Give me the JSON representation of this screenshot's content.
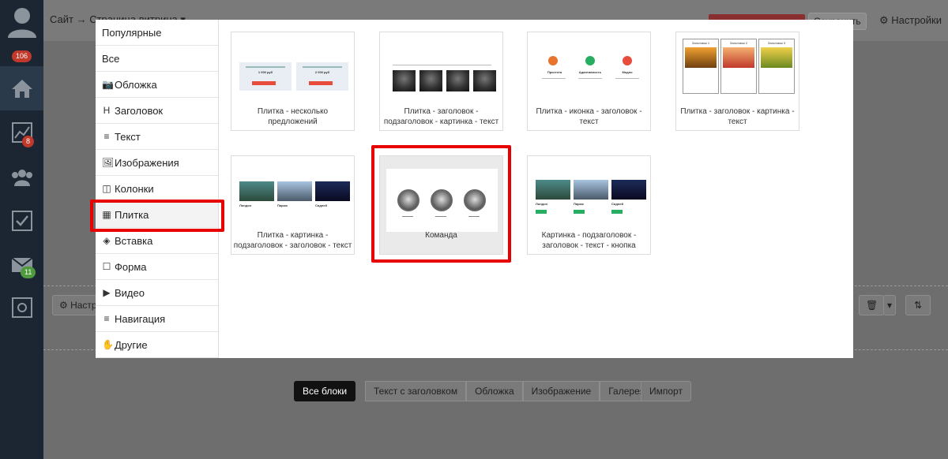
{
  "appbar": {
    "badges": {
      "notifications": "106",
      "stats": "8",
      "messages": "11"
    }
  },
  "topbar": {
    "breadcrumb": "Сайт → Страница витрина ▾",
    "hidden_action": "Предпросмотр",
    "save_label": "Сохранить",
    "settings_label": "Настройки"
  },
  "background": {
    "block_settings_label": "Настр",
    "filters": [
      "Все блоки",
      "Текст с заголовком",
      "Обложка",
      "Изображение",
      "Галерея"
    ],
    "import_label": "Импорт"
  },
  "modal": {
    "categories": [
      {
        "icon": "",
        "label": "Популярные"
      },
      {
        "icon": "",
        "label": "Все"
      },
      {
        "icon": "📷",
        "label": "Обложка"
      },
      {
        "icon": "H",
        "label": "Заголовок"
      },
      {
        "icon": "≡",
        "label": "Текст"
      },
      {
        "icon": "🖼",
        "label": "Изображения"
      },
      {
        "icon": "◫",
        "label": "Колонки"
      },
      {
        "icon": "▦",
        "label": "Плитка"
      },
      {
        "icon": "◈",
        "label": "Вставка"
      },
      {
        "icon": "☐",
        "label": "Форма"
      },
      {
        "icon": "▶",
        "label": "Видео"
      },
      {
        "icon": "≡",
        "label": "Навигация"
      },
      {
        "icon": "✋",
        "label": "Другие"
      }
    ],
    "selected_category": "Плитка",
    "cards": [
      {
        "label": "Плитка - несколько предложений"
      },
      {
        "label": "Плитка - заголовок - подзаголовок - картинка - текст"
      },
      {
        "label": "Плитка - иконка - заголовок - текст"
      },
      {
        "label": "Плитка - заголовок - картинка - текст"
      },
      {
        "label": "Плитка - картинка - подзаголовок - заголовок - текст"
      },
      {
        "label": "Команда"
      },
      {
        "label": "Картинка - подзаголовок - заголовок - текст - кнопка"
      }
    ],
    "selected_card": "Команда",
    "thumb_text": {
      "price_1": "1 000 руб",
      "price_2": "2 000 руб",
      "tile_1": "Заголовок 1",
      "tile_2": "Заголовок 2",
      "tile_3": "Заголовок 3",
      "icon_col_1": "Простота",
      "icon_col_2": "Адаптивность",
      "icon_col_3": "Модно",
      "city_1": "Лондон",
      "city_2": "Париж",
      "city_3": "Сидней"
    }
  },
  "colors": {
    "highlight": "#e60000",
    "sidebar": "#1b2632",
    "accent_red": "#e74c3c",
    "accent_green": "#27ae60"
  }
}
